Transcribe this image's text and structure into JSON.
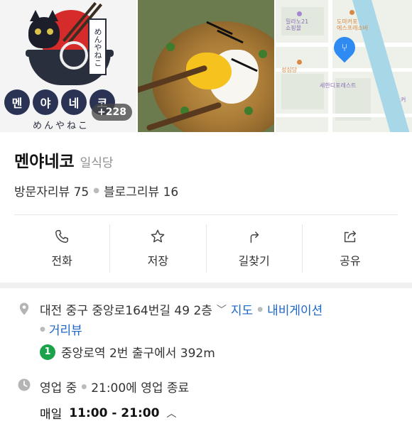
{
  "gallery": {
    "photo_count_badge": "+228",
    "logo_text": [
      "멘",
      "야",
      "네",
      "코"
    ],
    "logo_sub": "めんやねこ",
    "logo_vertical": "めんやねこ"
  },
  "map": {
    "labels": [
      "밀라노21",
      "쇼핑몰",
      "도마커포",
      "에스프레소바",
      "성심당",
      "세한디포레스트",
      "커"
    ],
    "pin_icon": "fork-knife-icon",
    "pin_color": "#2f8af2"
  },
  "place": {
    "name": "멘야네코",
    "category": "일식당",
    "visitor_reviews": "방문자리뷰 75",
    "blog_reviews": "블로그리뷰 16"
  },
  "actions": [
    {
      "label": "전화",
      "icon": "phone-icon"
    },
    {
      "label": "저장",
      "icon": "star-icon"
    },
    {
      "label": "길찾기",
      "icon": "directions-icon"
    },
    {
      "label": "공유",
      "icon": "share-icon"
    }
  ],
  "address": {
    "text": "대전 중구 중앙로164번길 49 2층",
    "map_link": "지도",
    "navigation_link": "내비게이션",
    "street_view_link": "거리뷰"
  },
  "subway": {
    "line": "1",
    "line_color": "#1ba34a",
    "text": "중앙로역 2번 출구에서 392m"
  },
  "hours": {
    "status": "영업 중",
    "closing": "21:00에 영업 종료",
    "day": "매일",
    "time": "11:00 - 21:00"
  },
  "colors": {
    "link": "#1d66c9",
    "logo_badge": "#2a3354"
  }
}
